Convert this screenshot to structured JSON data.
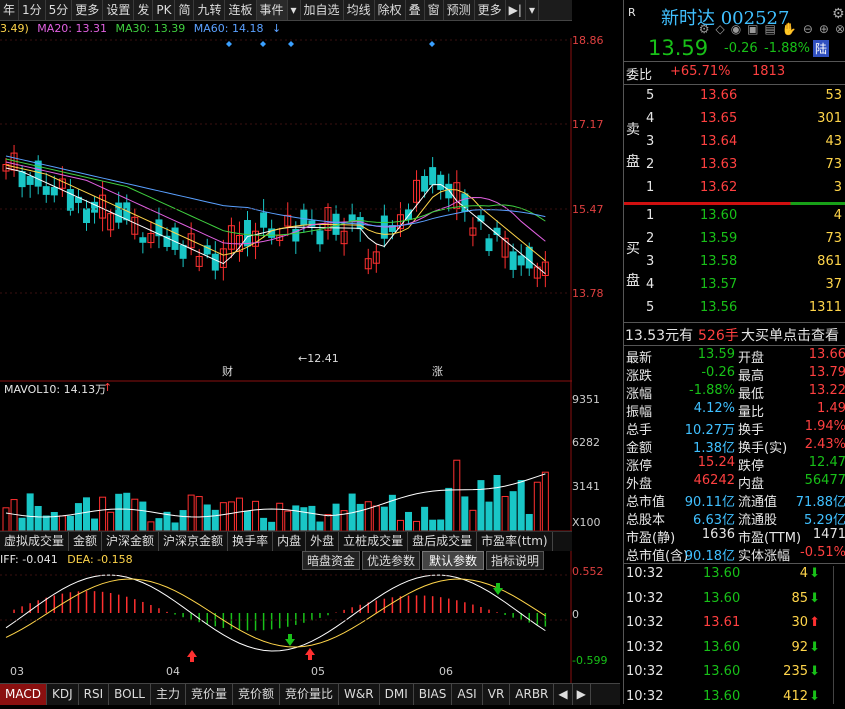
{
  "toolbar": {
    "items": [
      "年",
      "1分",
      "5分",
      "更多",
      "设置",
      "发",
      "PK",
      "简",
      "九转",
      "连板",
      "事件",
      "▾",
      "加自选",
      "均线",
      "除权",
      "叠",
      "窗",
      "预测",
      "更多",
      "▶|",
      "▾"
    ]
  },
  "ma": {
    "ma10": "3.49)",
    "ma20": "MA20: 13.31",
    "ma30": "MA30: 13.39",
    "ma60": "MA60: 14.18"
  },
  "price_axis": {
    "labels": [
      "18.86",
      "17.17",
      "15.47",
      "13.78"
    ]
  },
  "kline": {
    "low_marker": "←12.41",
    "event_tags": [
      "财",
      "涨"
    ]
  },
  "volume": {
    "title": "MAVOL10: 14.13万",
    "axis": [
      "9351",
      "6282",
      "3141",
      "X100"
    ]
  },
  "vol_tabs": [
    "虚拟成交量",
    "金额",
    "沪深金额",
    "沪深京金额",
    "换手率",
    "内盘",
    "外盘",
    "立桩成交量",
    "盘后成交量",
    "市盈率(ttm)"
  ],
  "macd": {
    "diff": "IFF: -0.041",
    "dea": "DEA: -0.158",
    "buttons": [
      "暗盘资金",
      "优选参数",
      "默认参数",
      "指标说明"
    ],
    "axis": [
      "0.552",
      "0",
      "-0.599"
    ],
    "months": [
      "03",
      "04",
      "05",
      "06"
    ]
  },
  "bottom_tabs": [
    "MACD",
    "KDJ",
    "RSI",
    "BOLL",
    "主力",
    "竞价量",
    "竞价额",
    "竞价量比",
    "W&R",
    "DMI",
    "BIAS",
    "ASI",
    "VR",
    "ARBR"
  ],
  "stock": {
    "r_label": "R",
    "name": "新时达 002527",
    "price": "13.59",
    "change": "-0.26",
    "pct": "-1.88%",
    "tag": "陆",
    "weibi_label": "委比",
    "weibi": "+65.71%",
    "weicha": "1813",
    "sell_label": [
      "卖",
      "盘"
    ],
    "buy_label": [
      "买",
      "盘"
    ],
    "asks": [
      {
        "lvl": "5",
        "price": "13.66",
        "vol": "53"
      },
      {
        "lvl": "4",
        "price": "13.65",
        "vol": "301"
      },
      {
        "lvl": "3",
        "price": "13.64",
        "vol": "43"
      },
      {
        "lvl": "2",
        "price": "13.63",
        "vol": "73"
      },
      {
        "lvl": "1",
        "price": "13.62",
        "vol": "3"
      }
    ],
    "bids": [
      {
        "lvl": "1",
        "price": "13.60",
        "vol": "4"
      },
      {
        "lvl": "2",
        "price": "13.59",
        "vol": "73"
      },
      {
        "lvl": "3",
        "price": "13.58",
        "vol": "861"
      },
      {
        "lvl": "4",
        "price": "13.57",
        "vol": "37"
      },
      {
        "lvl": "5",
        "price": "13.56",
        "vol": "1311"
      }
    ],
    "bigorder": {
      "amt": "13.53元有",
      "hands": "526手",
      "text": "大买单点击查看"
    },
    "quote": [
      {
        "l1": "最新",
        "v1": "13.59",
        "l2": "开盘",
        "v2": "13.66"
      },
      {
        "l1": "涨跌",
        "v1": "-0.26",
        "l2": "最高",
        "v2": "13.79"
      },
      {
        "l1": "涨幅",
        "v1": "-1.88%",
        "l2": "最低",
        "v2": "13.22"
      },
      {
        "l1": "振幅",
        "v1": "4.12%",
        "l2": "量比",
        "v2": "1.49"
      },
      {
        "l1": "总手",
        "v1": "10.27万",
        "l2": "换手",
        "v2": "1.94%"
      },
      {
        "l1": "金额",
        "v1": "1.38亿",
        "l2": "换手(实)",
        "v2": "2.43%"
      },
      {
        "l1": "涨停",
        "v1": "15.24",
        "l2": "跌停",
        "v2": "12.47"
      },
      {
        "l1": "外盘",
        "v1": "46242",
        "l2": "内盘",
        "v2": "56477"
      },
      {
        "l1": "总市值",
        "v1": "90.11亿",
        "l2": "流通值",
        "v2": "71.88亿"
      },
      {
        "l1": "总股本",
        "v1": "6.63亿",
        "l2": "流通股",
        "v2": "5.29亿"
      },
      {
        "l1": "市盈(静)",
        "v1": "1636",
        "l2": "市盈(TTM)",
        "v2": "1471"
      },
      {
        "l1": "总市值(含)",
        "v1": "90.18亿",
        "l2": "实体涨幅",
        "v2": "-0.51%"
      }
    ],
    "ticks": [
      {
        "t": "10:32",
        "p": "13.60",
        "v": "4",
        "d": "down"
      },
      {
        "t": "10:32",
        "p": "13.60",
        "v": "85",
        "d": "down"
      },
      {
        "t": "10:32",
        "p": "13.61",
        "v": "30",
        "d": "up"
      },
      {
        "t": "10:32",
        "p": "13.60",
        "v": "92",
        "d": "down"
      },
      {
        "t": "10:32",
        "p": "13.60",
        "v": "235",
        "d": "down"
      },
      {
        "t": "10:32",
        "p": "13.60",
        "v": "412",
        "d": "down"
      }
    ]
  },
  "colors": {
    "up": "#ff3030",
    "down": "#19c6c6",
    "bg": "#000000"
  }
}
